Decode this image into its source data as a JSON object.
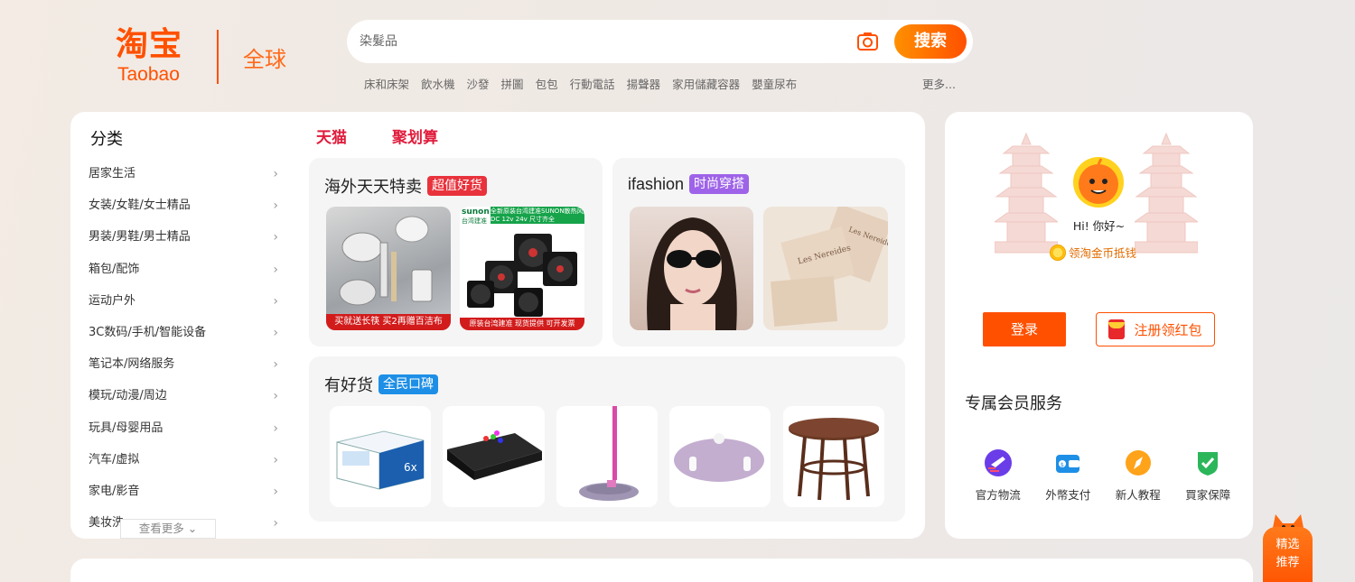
{
  "header": {
    "logo_cn": "淘宝",
    "logo_en": "Taobao",
    "logo_global": "全球",
    "search_placeholder": "染髮品",
    "search_button": "搜索",
    "hotwords": [
      "床和床架",
      "飲水機",
      "沙發",
      "拼圖",
      "包包",
      "行動電話",
      "揚聲器",
      "家用儲藏容器",
      "嬰童尿布"
    ],
    "more_words": "更多..."
  },
  "categories": {
    "title": "分类",
    "items": [
      "居家生活",
      "女装/女鞋/女士精品",
      "男装/男鞋/男士精品",
      "箱包/配饰",
      "运动户外",
      "3C数码/手机/智能设备",
      "笔记本/网络服务",
      "模玩/动漫/周边",
      "玩具/母婴用品",
      "汽车/虚拟",
      "家电/影音",
      "美妆洗"
    ],
    "see_more": "查看更多"
  },
  "brand_tabs": [
    "天猫",
    "聚划算"
  ],
  "cards": {
    "overseas": {
      "title": "海外天天特卖",
      "badge": "超值好货",
      "badge_color": "#e8323c",
      "img1_text": "买就送长筷 买2再赠百洁布",
      "img2_top": "全新原装台湾建准SUNON散热风扇",
      "img2_brand": "sunon",
      "img2_sub": "台湾建准",
      "img2_spec": "DC 12v 24v  尺寸齐全",
      "img2_bottom": "原装台湾建准  现货提供  可开发票"
    },
    "ifashion": {
      "title": "ifashion",
      "badge": "时尚穿搭",
      "badge_color": "#9e63e8"
    },
    "goods": {
      "title": "有好货",
      "badge": "全民口碑",
      "badge_color": "#1e8fe6"
    }
  },
  "user": {
    "greeting": "Hi! 你好~",
    "coin_link": "领淘金币抵钱",
    "login": "登录",
    "register": "注册领红包",
    "member_title": "专属会员服务",
    "services": [
      {
        "label": "官方物流",
        "icon": "shipping-icon",
        "color": "#6a3de8"
      },
      {
        "label": "外幣支付",
        "icon": "wallet-icon",
        "color": "#1e8fe6"
      },
      {
        "label": "新人教程",
        "icon": "compass-icon",
        "color": "#ff9a1a"
      },
      {
        "label": "買家保障",
        "icon": "shield-icon",
        "color": "#2bb65a"
      }
    ]
  },
  "float_button": {
    "line1": "精选",
    "line2": "推荐"
  }
}
